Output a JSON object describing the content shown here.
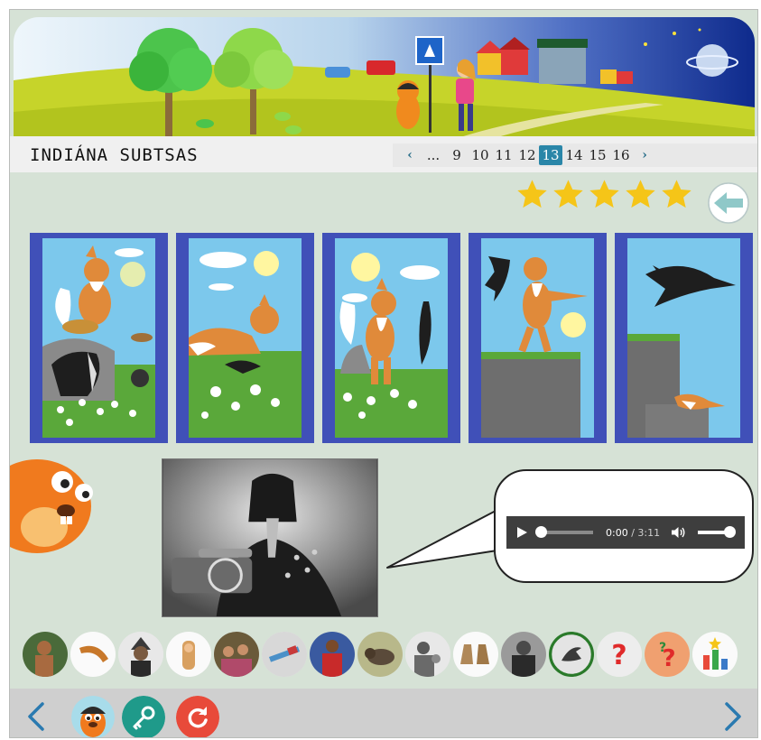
{
  "header": {
    "title": "INDIÁNA SUBTSAS"
  },
  "pagination": {
    "prev": "‹",
    "ellipsis": "...",
    "pages": [
      "9",
      "10",
      "11",
      "12",
      "13",
      "14",
      "15",
      "16"
    ],
    "current": "13",
    "next": "›"
  },
  "rating": {
    "stars": 5,
    "max": 5
  },
  "audio": {
    "current_time": "0:00",
    "separator": " / ",
    "duration": "3:11",
    "progress": 0.0,
    "volume": 1.0
  },
  "icons": {
    "back": "back-arrow-icon",
    "play": "play-icon",
    "volume": "volume-icon",
    "prev": "chevron-left-icon",
    "next": "chevron-right-icon",
    "key": "key-icon",
    "refresh": "refresh-icon"
  },
  "thumbnails": [
    "person-photo",
    "boomerang",
    "headdress-photo",
    "baby-cradle",
    "children-photo",
    "pipe",
    "red-figure",
    "bison",
    "mother-child-photo",
    "moccasins",
    "elder-photo",
    "raven",
    "question-mark",
    "question-hands",
    "trophy-chart"
  ],
  "colors": {
    "background": "#d6e2d6",
    "panel_border": "#4050b8",
    "active_page": "#2a86a8",
    "star": "#f5c518",
    "key_button": "#1f9a8a",
    "refresh_button": "#e84a3a",
    "arrow": "#2a7ab0"
  }
}
